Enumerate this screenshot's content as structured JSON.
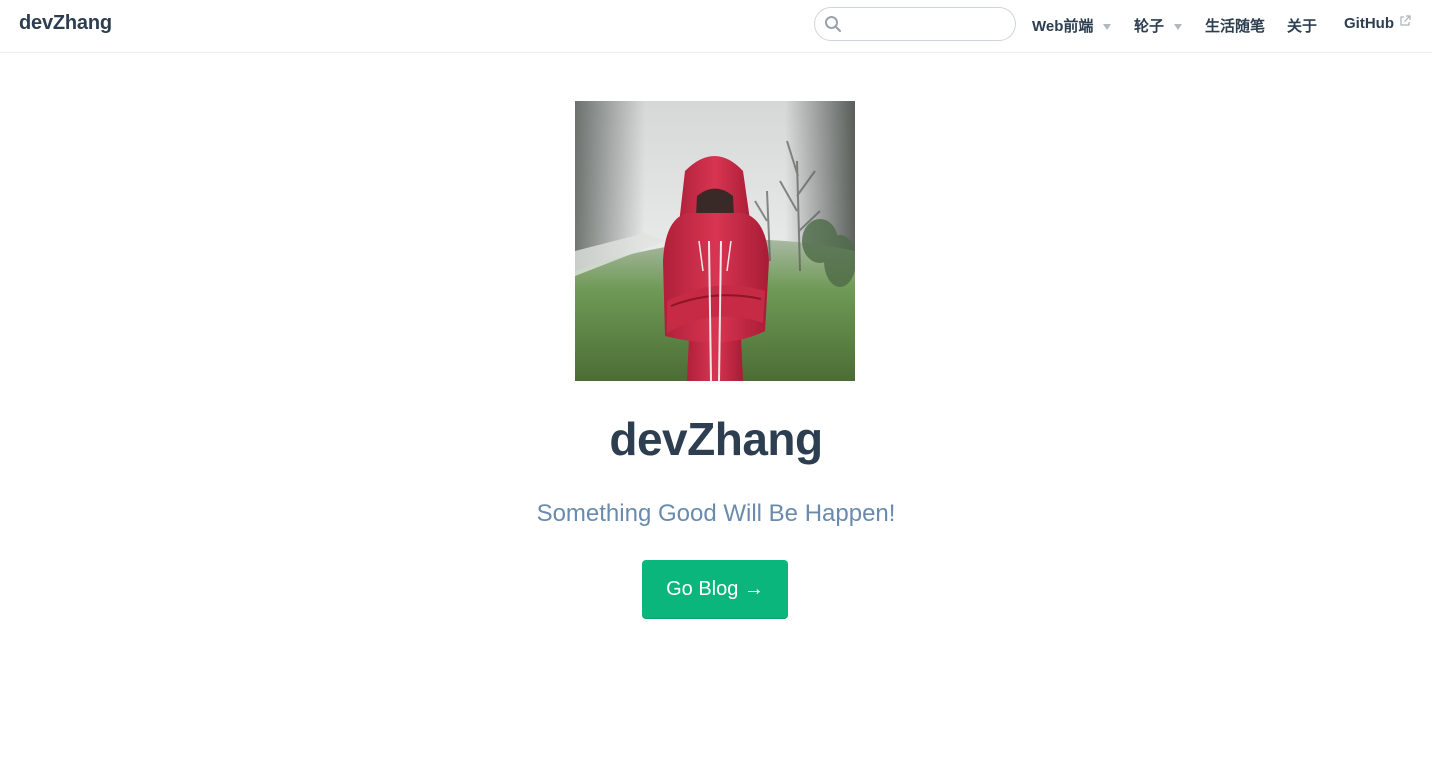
{
  "navbar": {
    "site_name": "devZhang",
    "search": {
      "placeholder": "",
      "value": ""
    },
    "items": [
      {
        "label": "Web前端",
        "dropdown": true
      },
      {
        "label": "轮子",
        "dropdown": true
      },
      {
        "label": "生活随笔",
        "dropdown": false
      },
      {
        "label": "关于",
        "dropdown": false
      },
      {
        "label": "GitHub",
        "external": true
      }
    ]
  },
  "hero": {
    "image_subject": "person in red hoodie standing in foggy field",
    "title": "devZhang",
    "description": "Something Good Will Be Happen!",
    "action_text": "Go Blog →"
  },
  "colors": {
    "accent": "#0ab67b",
    "text": "#2c3e50",
    "description": "#6a8bad",
    "border": "#eaecef"
  }
}
